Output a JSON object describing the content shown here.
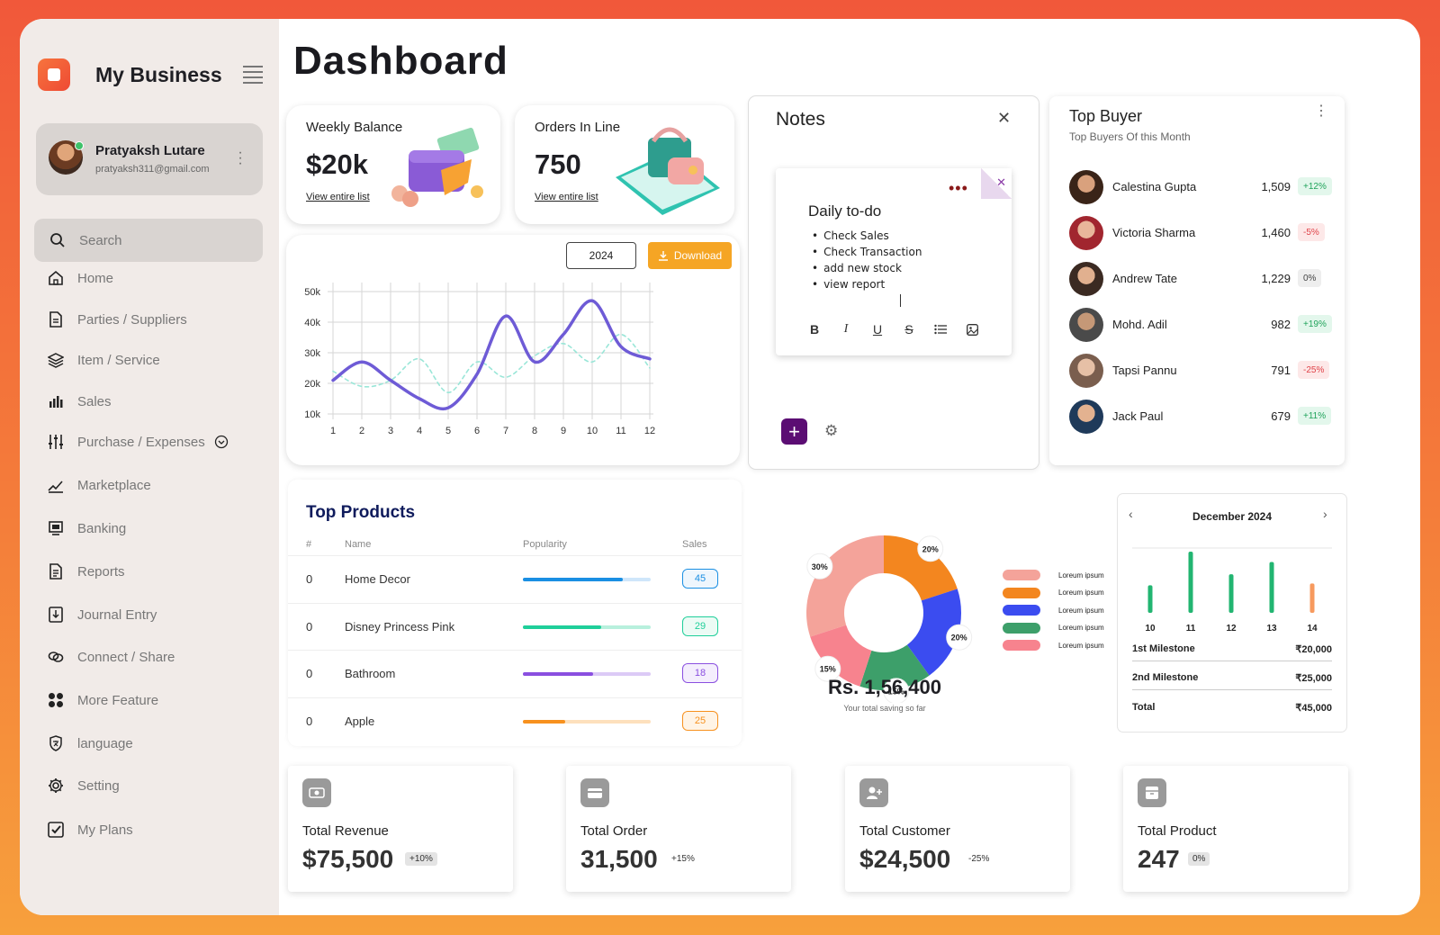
{
  "brand": {
    "name": "My Business"
  },
  "profile": {
    "name": "Pratyaksh Lutare",
    "email": "pratyaksh311@gmail.com"
  },
  "search": {
    "placeholder": "Search"
  },
  "nav": [
    {
      "label": "Home",
      "icon": "home-icon"
    },
    {
      "label": "Parties / Suppliers",
      "icon": "document-icon"
    },
    {
      "label": "Item / Service",
      "icon": "layers-icon"
    },
    {
      "label": "Sales",
      "icon": "bar-chart-icon"
    },
    {
      "label": "Purchase / Expenses",
      "icon": "sliders-icon"
    },
    {
      "label": "Marketplace",
      "icon": "marketplace-icon"
    },
    {
      "label": "Banking",
      "icon": "bank-icon"
    },
    {
      "label": "Reports",
      "icon": "report-icon"
    },
    {
      "label": "Journal Entry",
      "icon": "journal-icon"
    },
    {
      "label": "Connect / Share",
      "icon": "link-icon"
    },
    {
      "label": "More Feature",
      "icon": "grid-icon"
    },
    {
      "label": "language",
      "icon": "language-icon"
    },
    {
      "label": "Setting",
      "icon": "gear-icon"
    },
    {
      "label": "My Plans",
      "icon": "plans-icon"
    }
  ],
  "page": {
    "title": "Dashboard"
  },
  "weekly_balance": {
    "title": "Weekly Balance",
    "value": "$20k",
    "link": "View entire list"
  },
  "orders": {
    "title": "Orders In Line",
    "value": "750",
    "link": "View entire list"
  },
  "line_chart": {
    "year": "2024",
    "download_label": "Download"
  },
  "chart_data": {
    "type": "line",
    "x": [
      1,
      2,
      3,
      4,
      5,
      6,
      7,
      8,
      9,
      10,
      11,
      12
    ],
    "yticks": [
      "50k",
      "40k",
      "30k",
      "20k",
      "10k"
    ],
    "ylim": [
      10000,
      50000
    ],
    "series": [
      {
        "values": [
          21000,
          27000,
          21000,
          15000,
          12000,
          23000,
          42000,
          27000,
          36000,
          47000,
          32000,
          28000
        ],
        "color": "#6e5bd6"
      },
      {
        "values": [
          24000,
          19000,
          21000,
          28000,
          17000,
          27000,
          22000,
          29000,
          33000,
          27000,
          36000,
          25000
        ],
        "color": "#9ae6d8",
        "dashed": true
      }
    ]
  },
  "notes": {
    "title": "Notes",
    "note_title": "Daily to-do",
    "items": [
      "Check Sales",
      "Check Transaction",
      "add new stock",
      "view report"
    ],
    "toolbar": [
      "B",
      "I",
      "U",
      "S"
    ]
  },
  "top_buyer": {
    "title": "Top Buyer",
    "subtitle": "Top Buyers Of this Month",
    "buyers": [
      {
        "name": "Calestina Gupta",
        "value": "1,509",
        "change": "+12%",
        "tone": "up"
      },
      {
        "name": "Victoria Sharma",
        "value": "1,460",
        "change": "-5%",
        "tone": "down"
      },
      {
        "name": "Andrew Tate",
        "value": "1,229",
        "change": "0%",
        "tone": "flat"
      },
      {
        "name": "Mohd. Adil",
        "value": "982",
        "change": "+19%",
        "tone": "up"
      },
      {
        "name": "Tapsi Pannu",
        "value": "791",
        "change": "-25%",
        "tone": "down"
      },
      {
        "name": "Jack Paul",
        "value": "679",
        "change": "+11%",
        "tone": "up"
      }
    ]
  },
  "top_products": {
    "title": "Top Products",
    "headers": {
      "index": "#",
      "name": "Name",
      "popularity": "Popularity",
      "sales": "Sales"
    },
    "rows": [
      {
        "index": "0",
        "name": "Home Decor",
        "popularity": 0.78,
        "sales": "45",
        "color": "#1a8fe3",
        "track": "#cfe6fa",
        "badge_bg": "#eef6fd",
        "badge_border": "#1a8fe3"
      },
      {
        "index": "0",
        "name": "Disney Princess Pink",
        "popularity": 0.61,
        "sales": "29",
        "color": "#1fcf9a",
        "track": "#b8f0dd",
        "badge_bg": "#ecfbf5",
        "badge_border": "#1fcf9a"
      },
      {
        "index": "0",
        "name": "Bathroom",
        "popularity": 0.55,
        "sales": "18",
        "color": "#8a4fe0",
        "track": "#dccaf6",
        "badge_bg": "#f4eefd",
        "badge_border": "#8a4fe0"
      },
      {
        "index": "0",
        "name": "Apple",
        "popularity": 0.33,
        "sales": "25",
        "color": "#f7911e",
        "track": "#fde0bd",
        "badge_bg": "#fff4e6",
        "badge_border": "#f7911e"
      }
    ]
  },
  "savings": {
    "total": "Rs. 1,56,400",
    "caption": "Your total saving so far",
    "segments": [
      {
        "pct": 30,
        "label": "30%",
        "color": "#f4a39a"
      },
      {
        "pct": 20,
        "label": "20%",
        "color": "#f3861f"
      },
      {
        "pct": 20,
        "label": "20%",
        "color": "#3b4cf0"
      },
      {
        "pct": 15,
        "label": "15%",
        "color": "#3d9f6a"
      },
      {
        "pct": 15,
        "label": "15%",
        "color": "#f7838e"
      }
    ],
    "legend": [
      {
        "label": "Loreum ipsum",
        "color": "#f4a39a"
      },
      {
        "label": "Loreum ipsum",
        "color": "#f3861f"
      },
      {
        "label": "Loreum ipsum",
        "color": "#3b4cf0"
      },
      {
        "label": "Loreum ipsum",
        "color": "#3d9f6a"
      },
      {
        "label": "Loreum ipsum",
        "color": "#f7838e"
      }
    ]
  },
  "calendar": {
    "month": "December 2024",
    "bars": [
      {
        "day": "10",
        "value": 0.45,
        "color": "#22b571"
      },
      {
        "day": "11",
        "value": 1.0,
        "color": "#22b571"
      },
      {
        "day": "12",
        "value": 0.63,
        "color": "#22b571"
      },
      {
        "day": "13",
        "value": 0.83,
        "color": "#22b571"
      },
      {
        "day": "14",
        "value": 0.48,
        "color": "#f79a5e"
      }
    ],
    "milestones": [
      {
        "label": "1st Milestone",
        "value": "₹20,000"
      },
      {
        "label": "2nd Milestone",
        "value": "₹25,000"
      },
      {
        "label": "Total",
        "value": "₹45,000"
      }
    ]
  },
  "stats": [
    {
      "label": "Total Revenue",
      "value": "$75,500",
      "change": "+10%",
      "chip": true
    },
    {
      "label": "Total Order",
      "value": "31,500",
      "change": "+15%",
      "chip": false
    },
    {
      "label": "Total Customer",
      "value": "$24,500",
      "change": "-25%",
      "chip": false
    },
    {
      "label": "Total Product",
      "value": "247",
      "change": "0%",
      "chip": true
    }
  ]
}
